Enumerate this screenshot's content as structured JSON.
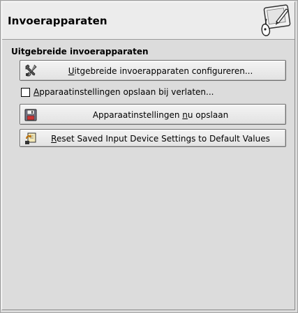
{
  "header": {
    "title": "Invoerapparaten",
    "icon": "input-devices-tablet-icon"
  },
  "section": {
    "title": "Uitgebreide invoerapparaten"
  },
  "buttons": {
    "configure": {
      "mnemonic": "U",
      "label_rest": "itgebreide invoerapparaten configureren...",
      "icon": "tools-icon"
    },
    "save_now": {
      "label_before": "Apparaatinstellingen ",
      "mnemonic": "n",
      "label_after": "u opslaan",
      "icon": "floppy-disk-icon"
    },
    "reset": {
      "mnemonic": "R",
      "label_rest": "eset Saved Input Device Settings to Default Values",
      "icon": "reset-icon"
    }
  },
  "checkbox": {
    "mnemonic": "A",
    "label_rest": "pparaatinstellingen opslaan bij verlaten...",
    "checked": false
  },
  "colors": {
    "background": "#dcdcdc",
    "header_background": "#ececec"
  }
}
